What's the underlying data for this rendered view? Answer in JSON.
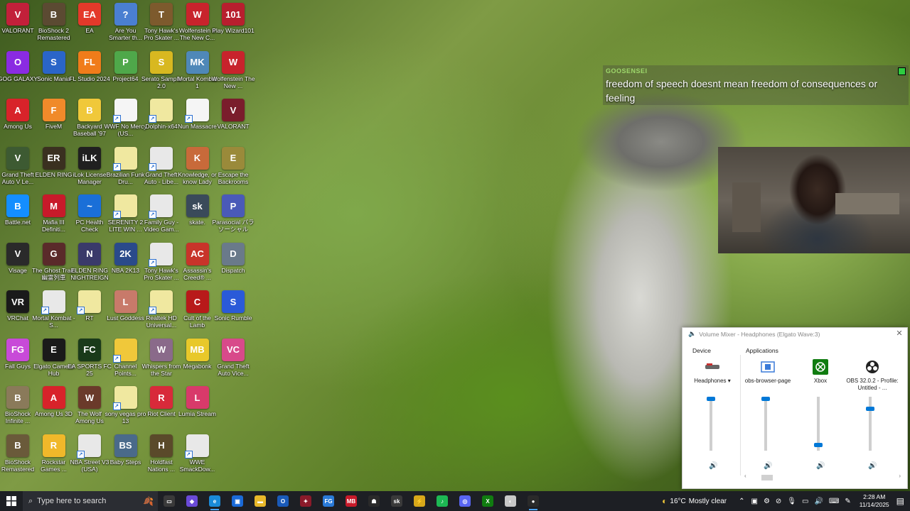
{
  "desktop_icons": [
    {
      "label": "VALORANT",
      "color": "#c2203a",
      "glyph": "V"
    },
    {
      "label": "BioShock 2 Remastered",
      "color": "#5b4a32",
      "glyph": "B"
    },
    {
      "label": "EA",
      "color": "#e4392a",
      "glyph": "EA"
    },
    {
      "label": "Are You Smarter th...",
      "color": "#4a7fd1",
      "glyph": "?"
    },
    {
      "label": "Tony Hawk's Pro Skater ...",
      "color": "#7d5a2d",
      "glyph": "T"
    },
    {
      "label": "Wolfenstein II The New C...",
      "color": "#c8232c",
      "glyph": "W"
    },
    {
      "label": "Play Wizard101",
      "color": "#b81f2e",
      "glyph": "101"
    },
    {
      "label": "GOG GALAXY",
      "color": "#8a2be2",
      "glyph": "O"
    },
    {
      "label": "Sonic Mania",
      "color": "#2a65c8",
      "glyph": "S"
    },
    {
      "label": "FL Studio 2024",
      "color": "#f07c1a",
      "glyph": "FL"
    },
    {
      "label": "Project64",
      "color": "#4fa84a",
      "glyph": "P"
    },
    {
      "label": "Serato Sample 2.0",
      "color": "#d8b820",
      "glyph": "S"
    },
    {
      "label": "Mortal Kombat 1",
      "color": "#4f88b8",
      "glyph": "MK"
    },
    {
      "label": "Wolfenstein The New ...",
      "color": "#c8232c",
      "glyph": "W"
    },
    {
      "label": "Among Us",
      "color": "#d8232a",
      "glyph": "A"
    },
    {
      "label": "FiveM",
      "color": "#f08a2a",
      "glyph": "F"
    },
    {
      "label": "Backyard Baseball '97",
      "color": "#f0c83a",
      "glyph": "B"
    },
    {
      "label": "WWF No Mercy (US...",
      "color": "#f5f5f5",
      "glyph": ""
    },
    {
      "label": "Dolphin-x64",
      "color": "#f0e8a0",
      "glyph": ""
    },
    {
      "label": "Nun Massacre",
      "color": "#f5f5f5",
      "glyph": ""
    },
    {
      "label": "VALORANT",
      "color": "#7a1d2c",
      "glyph": "V"
    },
    {
      "label": "Grand Theft Auto V Le...",
      "color": "#3d5a32",
      "glyph": "V"
    },
    {
      "label": "ELDEN RING",
      "color": "#3a3020",
      "glyph": "ER"
    },
    {
      "label": "iLok License Manager",
      "color": "#202020",
      "glyph": "iLK"
    },
    {
      "label": "Brazilian Funk Dru...",
      "color": "#f0e8a0",
      "glyph": ""
    },
    {
      "label": "Grand Theft Auto - Libe...",
      "color": "#e8e8e8",
      "glyph": ""
    },
    {
      "label": "Knowledge, or know Lady",
      "color": "#c86a3a",
      "glyph": "K"
    },
    {
      "label": "Escape the Backrooms",
      "color": "#9a8a3a",
      "glyph": "E"
    },
    {
      "label": "Battle.net",
      "color": "#148eff",
      "glyph": "B"
    },
    {
      "label": "Mafia III Definiti...",
      "color": "#c81a2a",
      "glyph": "M"
    },
    {
      "label": "PC Health Check",
      "color": "#1a6fd8",
      "glyph": "~"
    },
    {
      "label": "SERENITY 2 LITE WIN ...",
      "color": "#f0e8a0",
      "glyph": ""
    },
    {
      "label": "Family Guy - Video Gam...",
      "color": "#e8e8e8",
      "glyph": ""
    },
    {
      "label": "skate.",
      "color": "#3a4a5a",
      "glyph": "sk"
    },
    {
      "label": "Parasocial パラソーシャル",
      "color": "#4a5ab8",
      "glyph": "P"
    },
    {
      "label": "Visage",
      "color": "#2a2a2a",
      "glyph": "V"
    },
    {
      "label": "The Ghost Train 幽霊列車",
      "color": "#5a2a2a",
      "glyph": "G"
    },
    {
      "label": "ELDEN RING NIGHTREIGN",
      "color": "#3a3a6a",
      "glyph": "N"
    },
    {
      "label": "NBA 2K13",
      "color": "#2a4a8a",
      "glyph": "2K"
    },
    {
      "label": "Tony Hawk's Pro Skater ...",
      "color": "#e8e8e8",
      "glyph": ""
    },
    {
      "label": "Assassin's Creed® ...",
      "color": "#c8342a",
      "glyph": "AC"
    },
    {
      "label": "Dispatch",
      "color": "#6a7a8a",
      "glyph": "D"
    },
    {
      "label": "VRChat",
      "color": "#1a1a1a",
      "glyph": "VR"
    },
    {
      "label": "Mortal Kombat - S...",
      "color": "#e8e8e8",
      "glyph": ""
    },
    {
      "label": "RT",
      "color": "#f0e8a0",
      "glyph": ""
    },
    {
      "label": "Lust Goddess",
      "color": "#c87a6a",
      "glyph": "L"
    },
    {
      "label": "Realtek HD Universal...",
      "color": "#f0e8a0",
      "glyph": ""
    },
    {
      "label": "Cult of the Lamb",
      "color": "#b81a1a",
      "glyph": "C"
    },
    {
      "label": "Sonic Rumble",
      "color": "#2a5ad8",
      "glyph": "S"
    },
    {
      "label": "Fall Guys",
      "color": "#c84ad8",
      "glyph": "FG"
    },
    {
      "label": "Elgato Camera Hub",
      "color": "#1a1a1a",
      "glyph": "E"
    },
    {
      "label": "EA SPORTS FC 25",
      "color": "#1a3a1a",
      "glyph": "FC"
    },
    {
      "label": "Channel Points...",
      "color": "#f0c83a",
      "glyph": ""
    },
    {
      "label": "Whispers from the Star",
      "color": "#8a6a8a",
      "glyph": "W"
    },
    {
      "label": "Megabonk",
      "color": "#e8c82a",
      "glyph": "MB"
    },
    {
      "label": "Grand Theft Auto Vice...",
      "color": "#d84a8a",
      "glyph": "VC"
    },
    {
      "label": "BioShock Infinite ...",
      "color": "#8a7a5a",
      "glyph": "B"
    },
    {
      "label": "Among Us 3D",
      "color": "#d8232a",
      "glyph": "A"
    },
    {
      "label": "The Wolf Among Us",
      "color": "#6a3a2a",
      "glyph": "W"
    },
    {
      "label": "sony vegas pro 13",
      "color": "#f0e8a0",
      "glyph": ""
    },
    {
      "label": "Riot Client",
      "color": "#d82a3a",
      "glyph": "R"
    },
    {
      "label": "Lumia Stream",
      "color": "#d83a6a",
      "glyph": "L"
    },
    {
      "label": "",
      "color": "rgba(0,0,0,0)",
      "glyph": ""
    },
    {
      "label": "BioShock Remastered",
      "color": "#6a5a3a",
      "glyph": "B"
    },
    {
      "label": "Rockstar Games ...",
      "color": "#f0b82a",
      "glyph": "R"
    },
    {
      "label": "NBA Street V3 (USA)",
      "color": "#e8e8e8",
      "glyph": ""
    },
    {
      "label": "Baby Steps",
      "color": "#4a6a8a",
      "glyph": "BS"
    },
    {
      "label": "Holdfast Nations ...",
      "color": "#5a4a2a",
      "glyph": "H"
    },
    {
      "label": "WWE SmackDow...",
      "color": "#e8e8e8",
      "glyph": ""
    }
  ],
  "chat": {
    "username": "GOOSENSEI",
    "message": "freedom of speech doesnt mean freedom of consequences or feeling"
  },
  "mixer": {
    "title": "Volume Mixer - Headphones (Elgato Wave:3)",
    "device_header": "Device",
    "apps_header": "Applications",
    "device": {
      "name": "Headphones ▾",
      "level": 1.0
    },
    "apps": [
      {
        "name": "obs-browser-page",
        "level": 1.0
      },
      {
        "name": "Xbox",
        "level": 0.07
      },
      {
        "name": "OBS 32.0.2 - Profile: Untitled - ...",
        "level": 0.8
      }
    ],
    "accent": "#0078d7"
  },
  "taskbar": {
    "search_placeholder": "Type here to search",
    "apps": [
      {
        "name": "task-view",
        "color": "#3a3a3a",
        "glyph": "▭",
        "active": false
      },
      {
        "name": "copilot",
        "color": "#6a4ad8",
        "glyph": "◆",
        "active": false
      },
      {
        "name": "edge",
        "color": "#1a8ad8",
        "glyph": "e",
        "active": true
      },
      {
        "name": "store",
        "color": "#1a6ad8",
        "glyph": "▣",
        "active": false
      },
      {
        "name": "file-explorer",
        "color": "#e8b82a",
        "glyph": "▬",
        "active": false
      },
      {
        "name": "outlook",
        "color": "#1a5ab8",
        "glyph": "O",
        "active": false
      },
      {
        "name": "game-red",
        "color": "#8a1a2a",
        "glyph": "✦",
        "active": false
      },
      {
        "name": "fall-guys",
        "color": "#2a7ad8",
        "glyph": "FG",
        "active": false
      },
      {
        "name": "megabonk",
        "color": "#c81a2a",
        "glyph": "MB",
        "active": false
      },
      {
        "name": "game-dark",
        "color": "#2a2a2a",
        "glyph": "☗",
        "active": false
      },
      {
        "name": "skate",
        "color": "#3a3a3a",
        "glyph": "sk",
        "active": false
      },
      {
        "name": "game-yellow",
        "color": "#d8a81a",
        "glyph": "⚡",
        "active": false
      },
      {
        "name": "spotify",
        "color": "#1db954",
        "glyph": "♪",
        "active": false
      },
      {
        "name": "discord",
        "color": "#5865f2",
        "glyph": "◎",
        "active": false
      },
      {
        "name": "xbox",
        "color": "#107c10",
        "glyph": "X",
        "active": false
      },
      {
        "name": "app-white",
        "color": "#c8c8c8",
        "glyph": "◐",
        "active": false
      },
      {
        "name": "obs",
        "color": "#2a2a2a",
        "glyph": "●",
        "active": true
      }
    ],
    "weather_temp": "16°C",
    "weather_desc": "Mostly clear",
    "time": "2:28 AM",
    "date": "11/14/2025"
  }
}
